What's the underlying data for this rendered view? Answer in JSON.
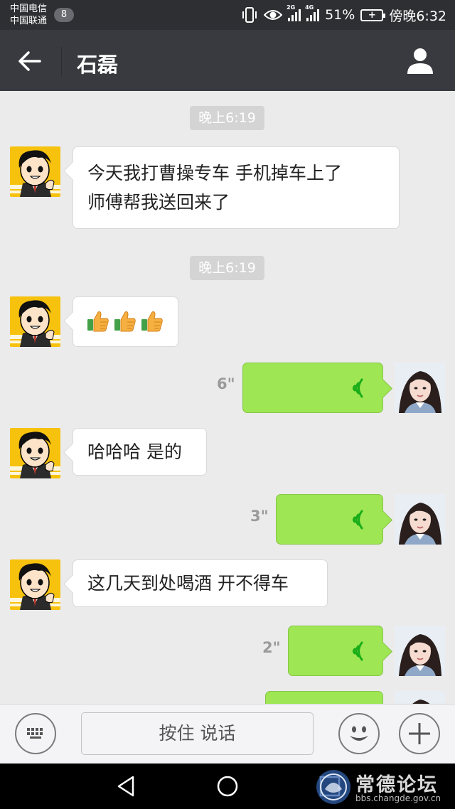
{
  "status_bar": {
    "carrier_1": "中国电信",
    "carrier_2": "中国联通",
    "notification_count": "8",
    "signal_1_label": "2G",
    "signal_2_label": "4G",
    "battery_percent": "51%",
    "time": "傍晚6:32"
  },
  "header": {
    "title": "石磊",
    "back_icon": "arrow-left-icon",
    "profile_icon": "person-icon"
  },
  "messages": [
    {
      "type": "timestamp",
      "text": "晚上6:19"
    },
    {
      "type": "text",
      "direction": "in",
      "lines": [
        "今天我打曹操专车 手机掉车上了",
        "师傅帮我送回来了"
      ]
    },
    {
      "type": "timestamp",
      "text": "晚上6:19"
    },
    {
      "type": "emoji",
      "direction": "in",
      "emoji": "thumbs-up",
      "count": 3
    },
    {
      "type": "voice",
      "direction": "out",
      "duration": "6\""
    },
    {
      "type": "text",
      "direction": "in",
      "lines": [
        "哈哈哈 是的"
      ]
    },
    {
      "type": "voice",
      "direction": "out",
      "duration": "3\""
    },
    {
      "type": "text",
      "direction": "in",
      "lines": [
        "这几天到处喝酒 开不得车"
      ]
    },
    {
      "type": "voice",
      "direction": "out",
      "duration": "2\""
    }
  ],
  "input_bar": {
    "hold_to_talk": "按住 说话",
    "keyboard_icon": "keyboard-icon",
    "emoji_icon": "smiley-icon",
    "plus_icon": "plus-icon"
  },
  "watermark": {
    "text": "常德论坛",
    "url": "bbs.changde.gov.cn"
  },
  "colors": {
    "status_bar": "#2e2f33",
    "title_bar": "#393a3f",
    "chat_bg": "#ebebeb",
    "outgoing_bubble": "#9ee653",
    "voice_wave": "#1aad19"
  }
}
